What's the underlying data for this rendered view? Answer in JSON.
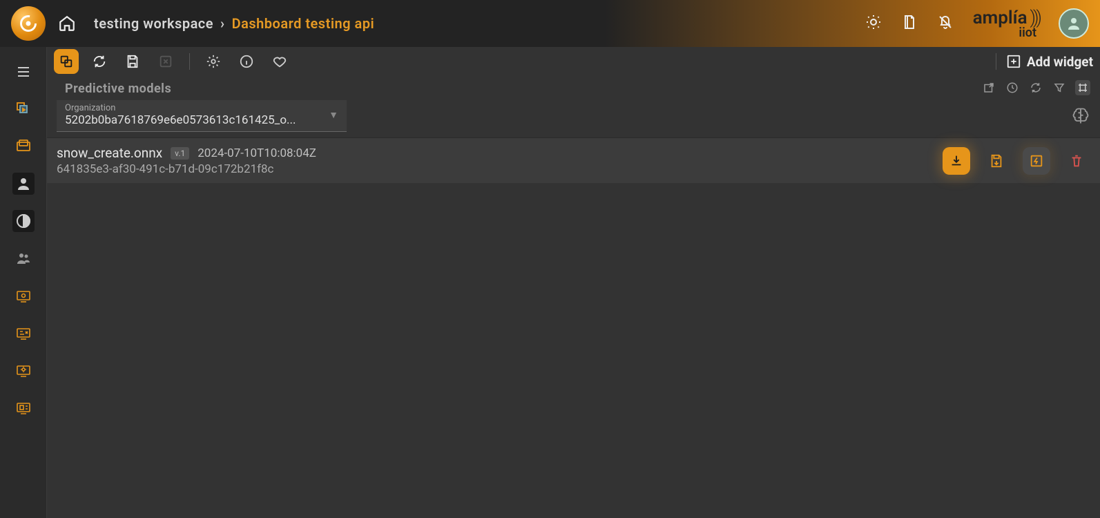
{
  "breadcrumb": {
    "parent": "testing workspace",
    "active": "Dashboard testing api"
  },
  "brand": {
    "name": "amplía",
    "sub": "iiot"
  },
  "toolbar": {
    "add_widget": "Add widget"
  },
  "panel": {
    "title": "Predictive models",
    "org_label": "Organization",
    "org_value": "5202b0ba7618769e6e0573613c161425_o..."
  },
  "model": {
    "name": "snow_create.onnx",
    "version": "v.1",
    "timestamp": "2024-07-10T10:08:04Z",
    "id": "641835e3-af30-491c-b71d-09c172b21f8c"
  }
}
